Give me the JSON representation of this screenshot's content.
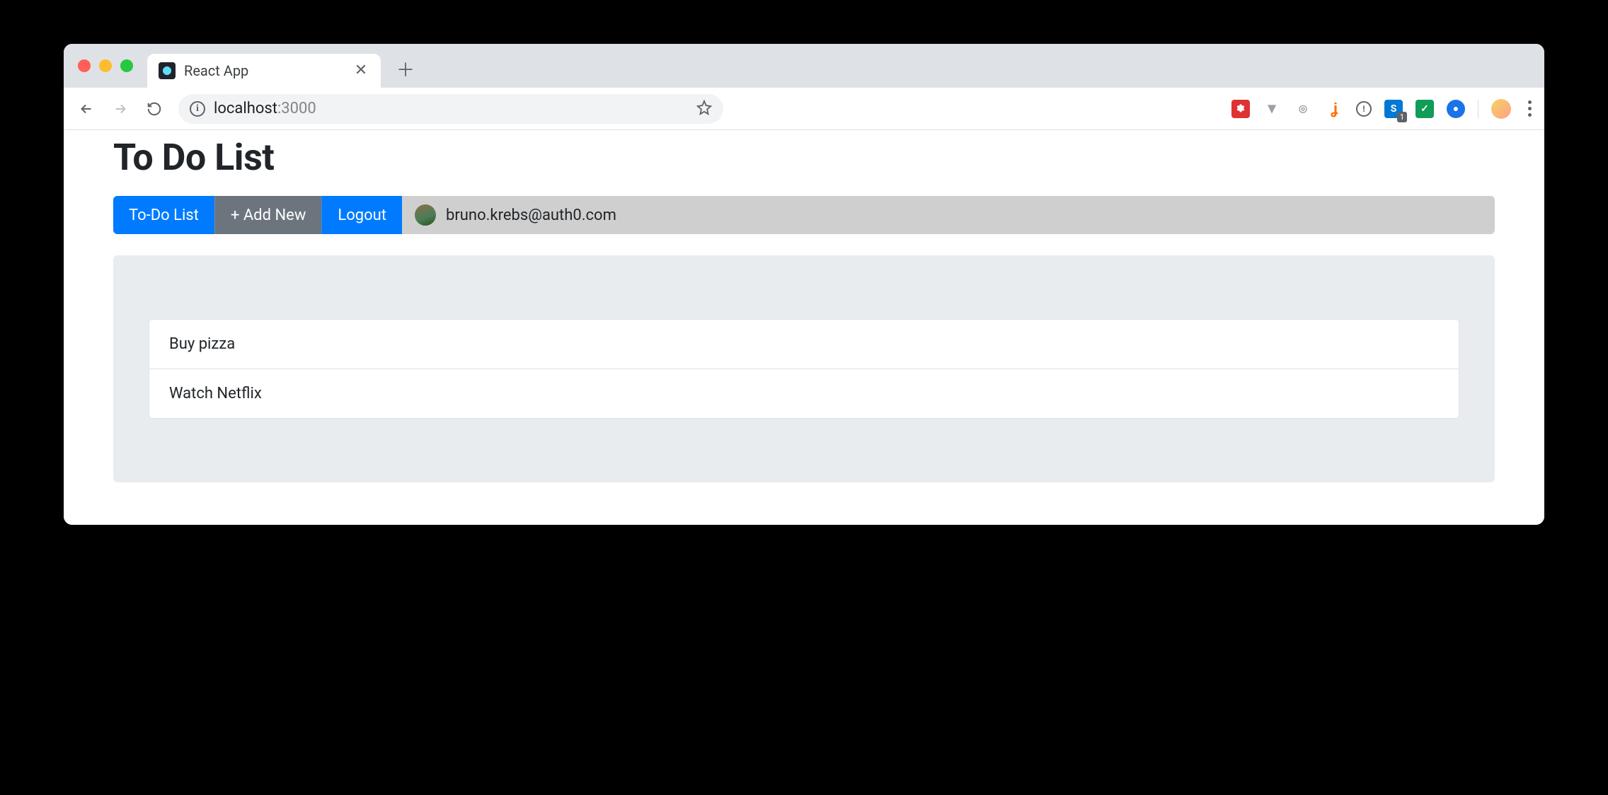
{
  "browser": {
    "tab_title": "React App",
    "url_host": "localhost",
    "url_port": ":3000",
    "ext_badge": "1"
  },
  "page": {
    "heading": "To Do List",
    "nav": {
      "todo_label": "To-Do List",
      "add_label": "+ Add New",
      "logout_label": "Logout"
    },
    "user": {
      "email": "bruno.krebs@auth0.com"
    },
    "todos": [
      {
        "text": "Buy pizza"
      },
      {
        "text": "Watch Netflix"
      }
    ]
  }
}
